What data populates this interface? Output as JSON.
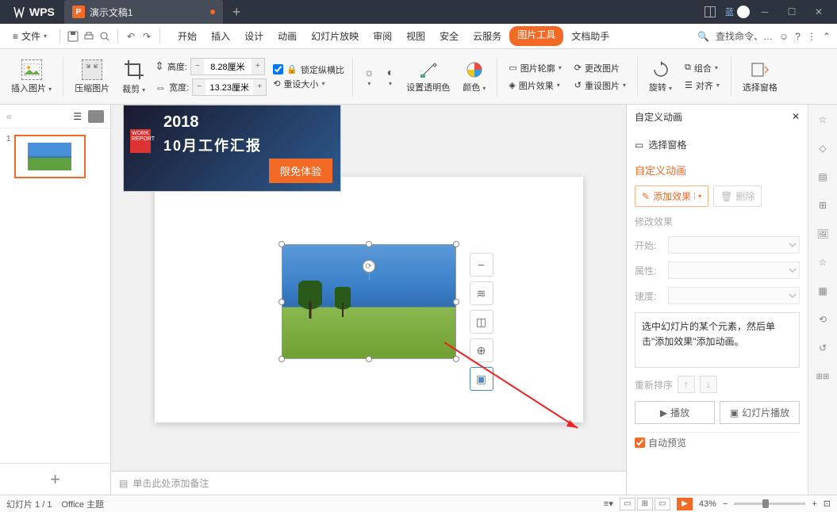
{
  "titlebar": {
    "app": "WPS",
    "tab_title": "演示文稿1",
    "blue_label": "蓝"
  },
  "menubar": {
    "file": "文件",
    "search_placeholder": "查找命令、…",
    "items": [
      "开始",
      "插入",
      "设计",
      "动画",
      "幻灯片放映",
      "审阅",
      "视图",
      "安全",
      "云服务",
      "图片工具",
      "文档助手"
    ]
  },
  "ribbon": {
    "insert_pic": "插入图片",
    "compress": "压缩图片",
    "crop": "裁剪",
    "height_label": "高度:",
    "height_value": "8.28厘米",
    "width_label": "宽度:",
    "width_value": "13.23厘米",
    "lock_aspect": "锁定纵横比",
    "reset_size": "重设大小",
    "set_trans": "设置透明色",
    "color": "颜色",
    "outline": "图片轮廓",
    "effect": "图片效果",
    "change_pic": "更改图片",
    "reset_pic": "重设图片",
    "rotate": "旋转",
    "combine": "组合",
    "align": "对齐",
    "sel_pane": "选择窗格"
  },
  "banner": {
    "year": "2018",
    "title": "10月工作汇报",
    "badge": "WORK REPORT",
    "try_btn": "限免体验"
  },
  "canvas": {
    "notes_placeholder": "单击此处添加备注"
  },
  "taskpane": {
    "title": "自定义动画",
    "sel_pane": "选择窗格",
    "section": "自定义动画",
    "add_effect": "添加效果",
    "delete": "删除",
    "modify": "修改效果",
    "start_label": "开始:",
    "prop_label": "属性:",
    "speed_label": "速度:",
    "hint": "选中幻灯片的某个元素，然后单击\"添加效果\"添加动画。",
    "reorder": "重新排序",
    "play": "播放",
    "slideshow": "幻灯片播放",
    "autoprev": "自动预览"
  },
  "statusbar": {
    "slide_count": "幻灯片 1 / 1",
    "theme": "Office 主题",
    "zoom": "43%"
  }
}
